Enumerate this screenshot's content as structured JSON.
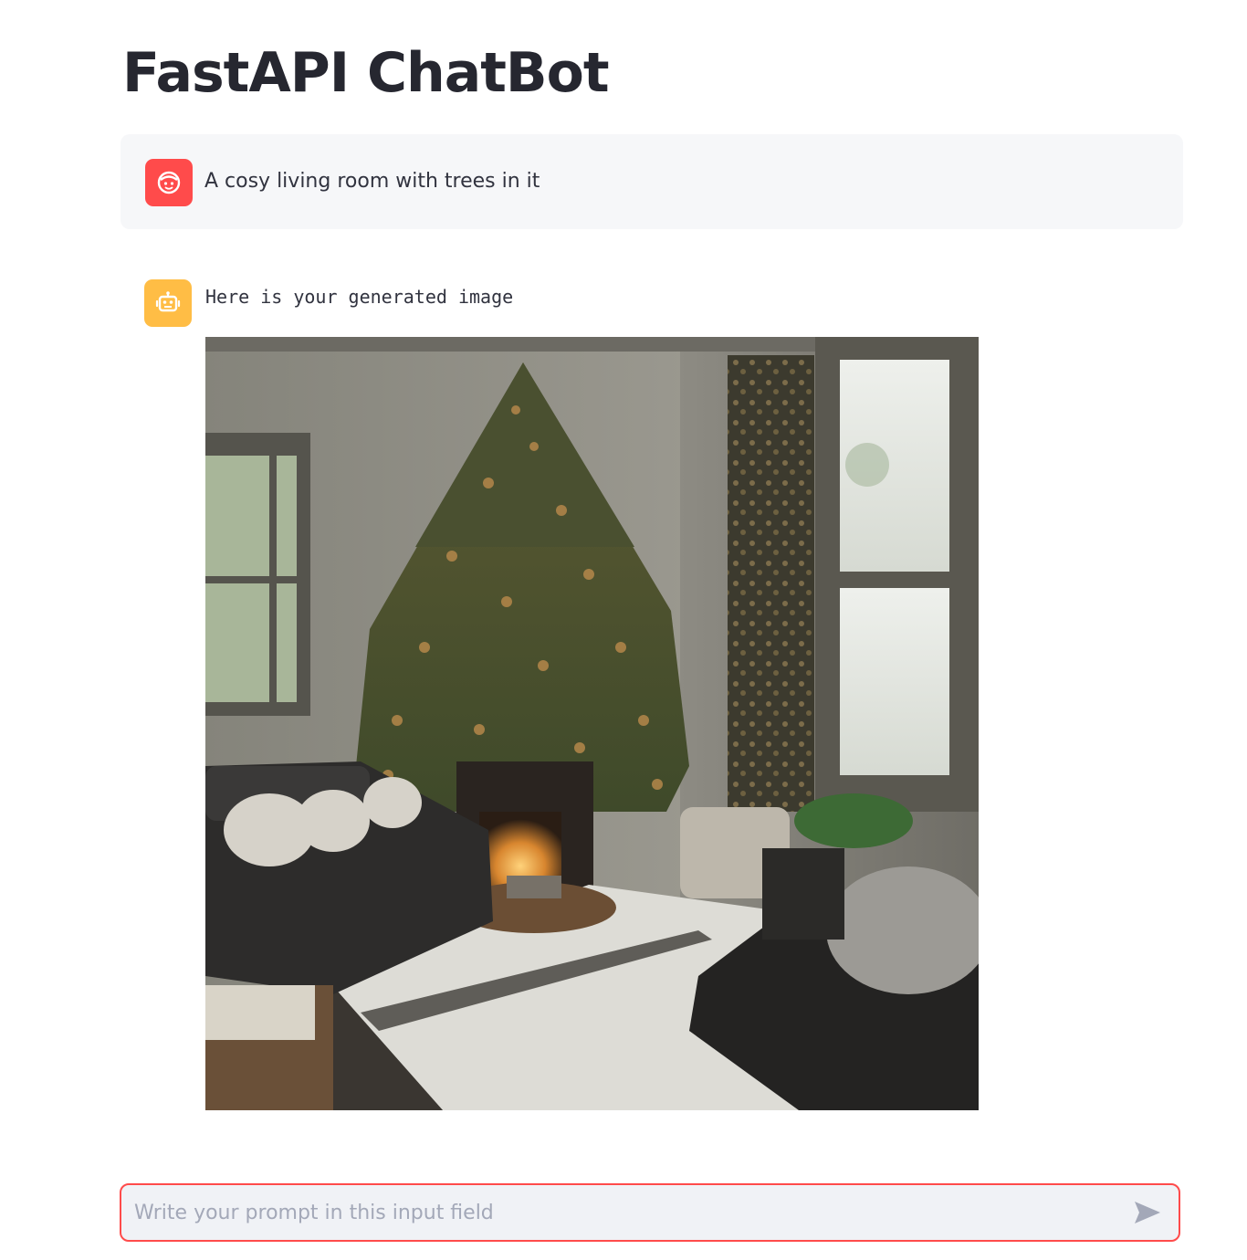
{
  "app": {
    "title": "FastAPI ChatBot"
  },
  "messages": [
    {
      "role": "user",
      "avatar_icon": "face-icon",
      "avatar_color": "#ff4b4b",
      "text": "A cosy living room with trees in it"
    },
    {
      "role": "assistant",
      "avatar_icon": "robot-icon",
      "avatar_color": "#ffbd45",
      "text": "Here is your generated image",
      "image_description": "Living room with a large decorated evergreen tree in the corner, fireplace, dark sofas with cushions, white rug and tall windows with curtains"
    }
  ],
  "chat_input": {
    "placeholder": "Write your prompt in this input field",
    "value": "",
    "send_icon": "send-icon",
    "accent_color": "#ff4b4b"
  }
}
